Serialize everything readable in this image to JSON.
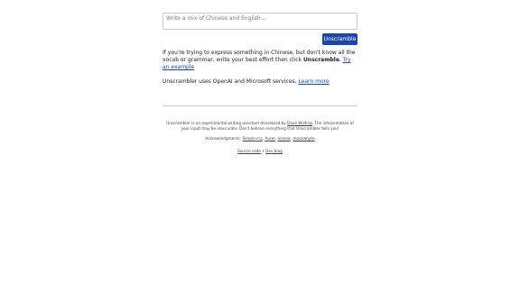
{
  "input": {
    "placeholder": "Write a mix of Chinese and English..."
  },
  "unscramble_button": "Unscramble",
  "intro": {
    "text_before": "If you're trying to express something in Chinese, but don't know all the vocab or grammar, write your best effort then click ",
    "bold_word": "Unscramble",
    "text_after": ". ",
    "link": "Try an example"
  },
  "services": {
    "text": "Unscrambler uses OpenAI and Microsoft services. ",
    "link": "Learn more"
  },
  "footer": {
    "desc_before": "Unscrambler is an experimental writing assistant developed by ",
    "author_link": "Dave Wilding",
    "desc_after": ". The interpretation of your input may be inaccurate. Don't believe everything that Unscrambler tells you!",
    "ack_label": "Acknowledgments: ",
    "ack_items": [
      "Simple.css",
      "Aurer",
      "Iconoir",
      "mackwhyte"
    ],
    "links": [
      "Source code",
      "Dev blog"
    ],
    "links_separator": " • "
  }
}
